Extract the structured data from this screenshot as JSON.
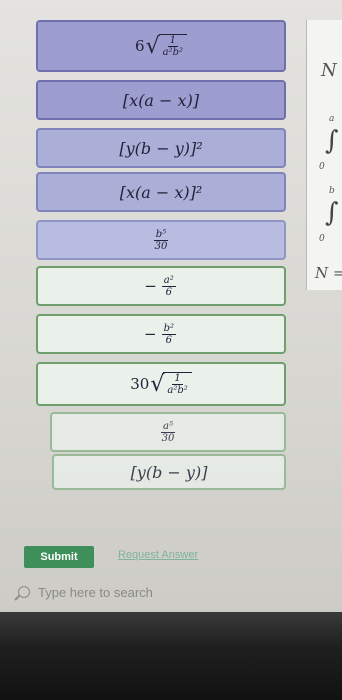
{
  "options": [
    {
      "coef": "6",
      "num": "1",
      "den": "a²b²"
    },
    {
      "expr": "[x(a − x)]"
    },
    {
      "expr": "[y(b − y)]²"
    },
    {
      "expr": "[x(a − x)]²"
    },
    {
      "num": "b⁵",
      "den": "30"
    },
    {
      "neg": "−",
      "num": "a²",
      "den": "6"
    },
    {
      "neg": "−",
      "num": "b²",
      "den": "6"
    },
    {
      "coef": "30",
      "num": "1",
      "den": "a²b²"
    },
    {
      "num": "a⁵",
      "den": "30"
    },
    {
      "expr": "[y(b − y)]"
    }
  ],
  "right_panel": {
    "n1": "N",
    "a": "a",
    "zero1": "0",
    "b": "b",
    "zero2": "0",
    "n2": "N ="
  },
  "actions": {
    "submit": "Submit",
    "request_answer": "Request Answer"
  },
  "search": {
    "placeholder": "Type here to search"
  }
}
